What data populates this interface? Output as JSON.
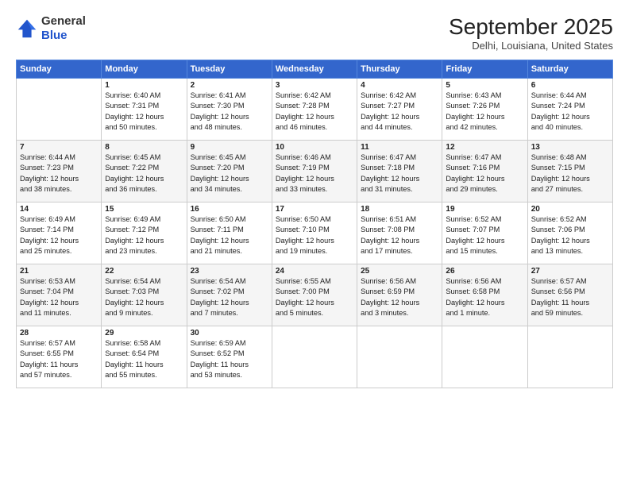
{
  "header": {
    "logo_line1": "General",
    "logo_line2": "Blue",
    "title": "September 2025",
    "subtitle": "Delhi, Louisiana, United States"
  },
  "days_of_week": [
    "Sunday",
    "Monday",
    "Tuesday",
    "Wednesday",
    "Thursday",
    "Friday",
    "Saturday"
  ],
  "weeks": [
    [
      {
        "day": "",
        "content": ""
      },
      {
        "day": "1",
        "content": "Sunrise: 6:40 AM\nSunset: 7:31 PM\nDaylight: 12 hours\nand 50 minutes."
      },
      {
        "day": "2",
        "content": "Sunrise: 6:41 AM\nSunset: 7:30 PM\nDaylight: 12 hours\nand 48 minutes."
      },
      {
        "day": "3",
        "content": "Sunrise: 6:42 AM\nSunset: 7:28 PM\nDaylight: 12 hours\nand 46 minutes."
      },
      {
        "day": "4",
        "content": "Sunrise: 6:42 AM\nSunset: 7:27 PM\nDaylight: 12 hours\nand 44 minutes."
      },
      {
        "day": "5",
        "content": "Sunrise: 6:43 AM\nSunset: 7:26 PM\nDaylight: 12 hours\nand 42 minutes."
      },
      {
        "day": "6",
        "content": "Sunrise: 6:44 AM\nSunset: 7:24 PM\nDaylight: 12 hours\nand 40 minutes."
      }
    ],
    [
      {
        "day": "7",
        "content": "Sunrise: 6:44 AM\nSunset: 7:23 PM\nDaylight: 12 hours\nand 38 minutes."
      },
      {
        "day": "8",
        "content": "Sunrise: 6:45 AM\nSunset: 7:22 PM\nDaylight: 12 hours\nand 36 minutes."
      },
      {
        "day": "9",
        "content": "Sunrise: 6:45 AM\nSunset: 7:20 PM\nDaylight: 12 hours\nand 34 minutes."
      },
      {
        "day": "10",
        "content": "Sunrise: 6:46 AM\nSunset: 7:19 PM\nDaylight: 12 hours\nand 33 minutes."
      },
      {
        "day": "11",
        "content": "Sunrise: 6:47 AM\nSunset: 7:18 PM\nDaylight: 12 hours\nand 31 minutes."
      },
      {
        "day": "12",
        "content": "Sunrise: 6:47 AM\nSunset: 7:16 PM\nDaylight: 12 hours\nand 29 minutes."
      },
      {
        "day": "13",
        "content": "Sunrise: 6:48 AM\nSunset: 7:15 PM\nDaylight: 12 hours\nand 27 minutes."
      }
    ],
    [
      {
        "day": "14",
        "content": "Sunrise: 6:49 AM\nSunset: 7:14 PM\nDaylight: 12 hours\nand 25 minutes."
      },
      {
        "day": "15",
        "content": "Sunrise: 6:49 AM\nSunset: 7:12 PM\nDaylight: 12 hours\nand 23 minutes."
      },
      {
        "day": "16",
        "content": "Sunrise: 6:50 AM\nSunset: 7:11 PM\nDaylight: 12 hours\nand 21 minutes."
      },
      {
        "day": "17",
        "content": "Sunrise: 6:50 AM\nSunset: 7:10 PM\nDaylight: 12 hours\nand 19 minutes."
      },
      {
        "day": "18",
        "content": "Sunrise: 6:51 AM\nSunset: 7:08 PM\nDaylight: 12 hours\nand 17 minutes."
      },
      {
        "day": "19",
        "content": "Sunrise: 6:52 AM\nSunset: 7:07 PM\nDaylight: 12 hours\nand 15 minutes."
      },
      {
        "day": "20",
        "content": "Sunrise: 6:52 AM\nSunset: 7:06 PM\nDaylight: 12 hours\nand 13 minutes."
      }
    ],
    [
      {
        "day": "21",
        "content": "Sunrise: 6:53 AM\nSunset: 7:04 PM\nDaylight: 12 hours\nand 11 minutes."
      },
      {
        "day": "22",
        "content": "Sunrise: 6:54 AM\nSunset: 7:03 PM\nDaylight: 12 hours\nand 9 minutes."
      },
      {
        "day": "23",
        "content": "Sunrise: 6:54 AM\nSunset: 7:02 PM\nDaylight: 12 hours\nand 7 minutes."
      },
      {
        "day": "24",
        "content": "Sunrise: 6:55 AM\nSunset: 7:00 PM\nDaylight: 12 hours\nand 5 minutes."
      },
      {
        "day": "25",
        "content": "Sunrise: 6:56 AM\nSunset: 6:59 PM\nDaylight: 12 hours\nand 3 minutes."
      },
      {
        "day": "26",
        "content": "Sunrise: 6:56 AM\nSunset: 6:58 PM\nDaylight: 12 hours\nand 1 minute."
      },
      {
        "day": "27",
        "content": "Sunrise: 6:57 AM\nSunset: 6:56 PM\nDaylight: 11 hours\nand 59 minutes."
      }
    ],
    [
      {
        "day": "28",
        "content": "Sunrise: 6:57 AM\nSunset: 6:55 PM\nDaylight: 11 hours\nand 57 minutes."
      },
      {
        "day": "29",
        "content": "Sunrise: 6:58 AM\nSunset: 6:54 PM\nDaylight: 11 hours\nand 55 minutes."
      },
      {
        "day": "30",
        "content": "Sunrise: 6:59 AM\nSunset: 6:52 PM\nDaylight: 11 hours\nand 53 minutes."
      },
      {
        "day": "",
        "content": ""
      },
      {
        "day": "",
        "content": ""
      },
      {
        "day": "",
        "content": ""
      },
      {
        "day": "",
        "content": ""
      }
    ]
  ]
}
